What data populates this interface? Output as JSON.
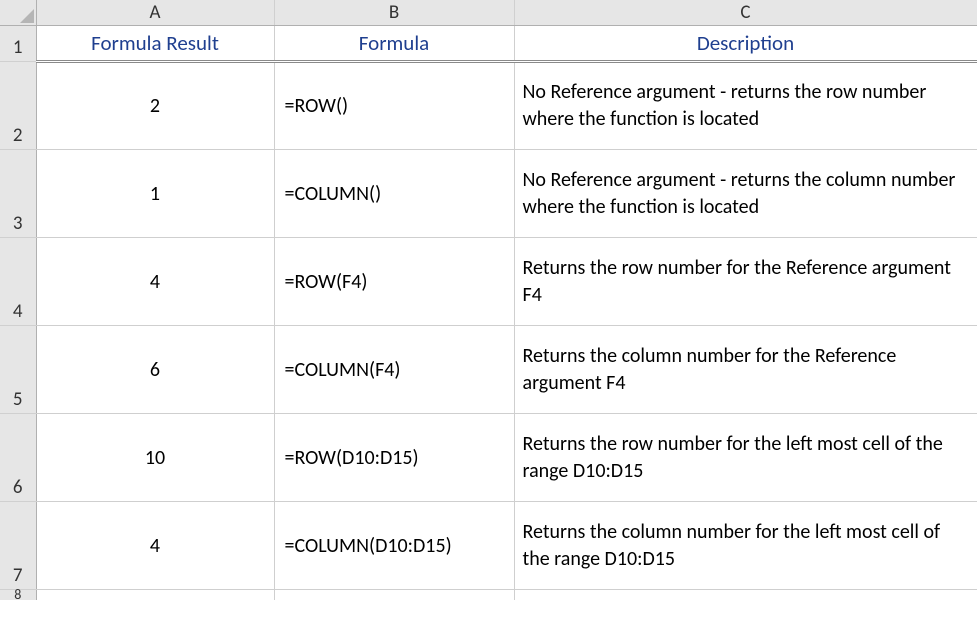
{
  "columns": {
    "A": "A",
    "B": "B",
    "C": "C"
  },
  "headers": {
    "A": "Formula Result",
    "B": "Formula",
    "C": "Description"
  },
  "rowLabels": {
    "r1": "1",
    "r2": "2",
    "r3": "3",
    "r4": "4",
    "r5": "5",
    "r6": "6",
    "r7": "7",
    "r8": "8"
  },
  "rows": [
    {
      "result": "2",
      "formula": "=ROW()",
      "description": "No Reference argument - returns the row number where the function is located"
    },
    {
      "result": "1",
      "formula": "=COLUMN()",
      "description": "No Reference argument - returns the column number where the function is located"
    },
    {
      "result": "4",
      "formula": "=ROW(F4)",
      "description": "Returns the row number for the Reference argument F4"
    },
    {
      "result": "6",
      "formula": "=COLUMN(F4)",
      "description": "Returns the column number for the Reference argument F4"
    },
    {
      "result": "10",
      "formula": "=ROW(D10:D15)",
      "description": "Returns the row number for the left most cell of the range D10:D15"
    },
    {
      "result": "4",
      "formula": "=COLUMN(D10:D15)",
      "description": "Returns the column number for the left most cell of the range D10:D15"
    }
  ],
  "chart_data": {
    "type": "table",
    "title": "",
    "columns": [
      "Formula Result",
      "Formula",
      "Description"
    ],
    "rows": [
      [
        "2",
        "=ROW()",
        "No Reference argument - returns the row number where the function is located"
      ],
      [
        "1",
        "=COLUMN()",
        "No Reference argument - returns the column number where the function is located"
      ],
      [
        "4",
        "=ROW(F4)",
        "Returns the row number for the Reference argument F4"
      ],
      [
        "6",
        "=COLUMN(F4)",
        "Returns the column number for the Reference argument F4"
      ],
      [
        "10",
        "=ROW(D10:D15)",
        "Returns the row number for the left most cell of the range D10:D15"
      ],
      [
        "4",
        "=COLUMN(D10:D15)",
        "Returns the column number for the left most cell of the range D10:D15"
      ]
    ]
  }
}
